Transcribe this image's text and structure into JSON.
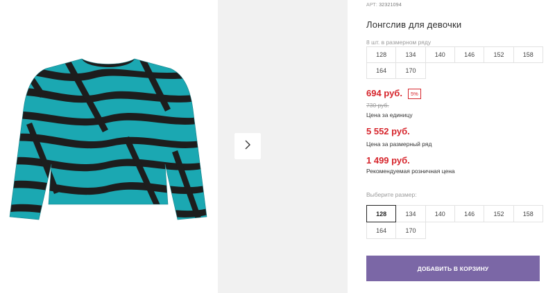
{
  "product": {
    "sku_label": "АРТ:",
    "sku_value": "32321094",
    "title": "Лонгслив для девочки",
    "pack_note": "8 шт. в размерном ряду",
    "pack_sizes": [
      "128",
      "134",
      "140",
      "146",
      "152",
      "158",
      "164",
      "170"
    ]
  },
  "prices": {
    "unit_price": "694 руб.",
    "discount": "5%",
    "old_price": "730 руб.",
    "unit_label": "Цена за единицу",
    "pack_price": "5 552 руб.",
    "pack_label": "Цена за размерный ряд",
    "recommended_price": "1 499 руб.",
    "recommended_label": "Рекомендуемая розничная цена"
  },
  "size_selector": {
    "label": "Выберите размер:",
    "sizes": [
      "128",
      "134",
      "140",
      "146",
      "152",
      "158",
      "164",
      "170"
    ],
    "selected": "128"
  },
  "actions": {
    "add_to_cart": "ДОБАВИТЬ В КОРЗИНУ"
  },
  "gallery": {
    "next_icon": "chevron-right-icon",
    "product_colors": {
      "base": "#1ba8b2",
      "stripe": "#1d1d1d"
    }
  },
  "colors": {
    "price_red": "#d6242b",
    "button_purple": "#7b67a6"
  }
}
